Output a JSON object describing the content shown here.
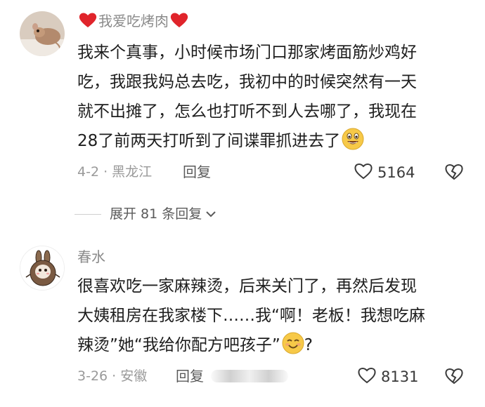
{
  "comments": [
    {
      "username": "我爱吃烤肉",
      "content_lines": [
        "我来个真事，小时候市场门口那家烤面筋炒鸡好",
        "吃，我跟我妈总去吃，我初中的时候突然有一天",
        "就不出摊了，怎么也打听不到人去哪了，我现在",
        "28了前两天打听到了间谍罪抓进去了"
      ],
      "meta": "4-2 · 黑龙江",
      "reply_label": "回复",
      "like_count": "5164"
    },
    {
      "username": "春水",
      "content_lines": [
        "很喜欢吃一家麻辣烫，后来关门了，再然后发现",
        "大姨租房在我家楼下……我“啊！老板！我想吃麻",
        "辣烫”她“我给你配方吧孩子”",
        "?"
      ],
      "meta": "3-26 · 安徽",
      "reply_label": "回复",
      "like_count": "8131"
    }
  ],
  "expand_replies": {
    "label": "展开 81 条回复"
  },
  "icons": {
    "heart_emoji": "red-heart-icon",
    "grin_emoji": "grinning-face-icon",
    "smile_emoji": "smiling-face-icon",
    "like": "heart-outline-icon",
    "dislike": "broken-heart-icon",
    "chevron": "chevron-down-icon"
  },
  "colors": {
    "heart": "#e0242b",
    "emoji_yellow": "#f7c948",
    "meta_text": "#9a9a9a",
    "body_text": "#1e1e1e"
  }
}
